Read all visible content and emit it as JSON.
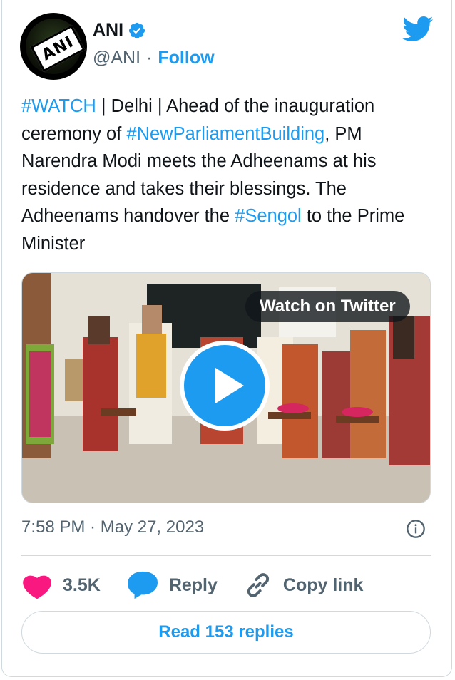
{
  "author": {
    "name": "ANI",
    "handle": "@ANI",
    "separator": "·",
    "follow_label": "Follow",
    "avatar_text": "ANI",
    "verified_icon": "verified-badge-icon",
    "platform_icon": "twitter-bird-icon"
  },
  "tweet": {
    "segments": [
      {
        "text": "#WATCH",
        "type": "hashtag"
      },
      {
        "text": " | Delhi | Ahead of the inauguration ceremony of ",
        "type": "text"
      },
      {
        "text": "#NewParliamentBuilding",
        "type": "hashtag"
      },
      {
        "text": ", PM Narendra Modi meets the Adheenams at his residence and takes their blessings. The Adheenams handover the ",
        "type": "text"
      },
      {
        "text": "#Sengol",
        "type": "hashtag"
      },
      {
        "text": " to the Prime Minister",
        "type": "text"
      }
    ]
  },
  "media": {
    "watch_label": "Watch on Twitter",
    "play_icon": "play-icon"
  },
  "meta": {
    "timestamp": "7:58 PM · May 27, 2023",
    "info_icon": "info-icon"
  },
  "actions": {
    "like_count": "3.5K",
    "reply_label": "Reply",
    "copy_label": "Copy link"
  },
  "read_replies_label": "Read 153 replies",
  "colors": {
    "accent": "#1d9bf0",
    "like": "#f91880",
    "muted": "#536471",
    "border": "#cfd9de"
  }
}
